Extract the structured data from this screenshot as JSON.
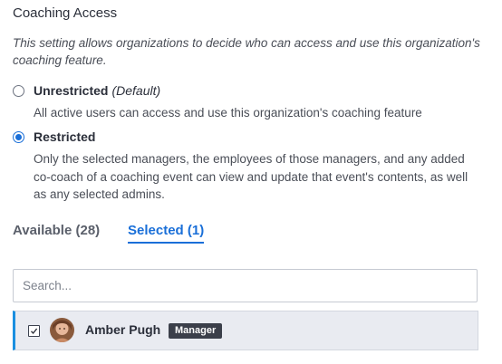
{
  "section": {
    "title": "Coaching Access",
    "description": "This setting allows organizations to decide who can access and use this organization's coaching feature."
  },
  "options": [
    {
      "label": "Unrestricted",
      "suffix": "(Default)",
      "help": "All active users can access and use this organization's coaching feature",
      "selected": false
    },
    {
      "label": "Restricted",
      "suffix": "",
      "help": "Only the selected managers, the employees of those managers, and any added co-coach of a coaching event can view and update that event's contents, as well as any selected admins.",
      "selected": true
    }
  ],
  "tabs": {
    "available": "Available (28)",
    "selected": "Selected (1)",
    "active": "selected"
  },
  "search": {
    "placeholder": "Search...",
    "value": ""
  },
  "selected_users": [
    {
      "name": "Amber Pugh",
      "role": "Manager",
      "checked": true
    }
  ],
  "colors": {
    "accent": "#1a6fd8",
    "row_highlight": "#e9ebf1",
    "row_border_accent": "#1a8fe0",
    "badge_bg": "#3b3f4a"
  }
}
